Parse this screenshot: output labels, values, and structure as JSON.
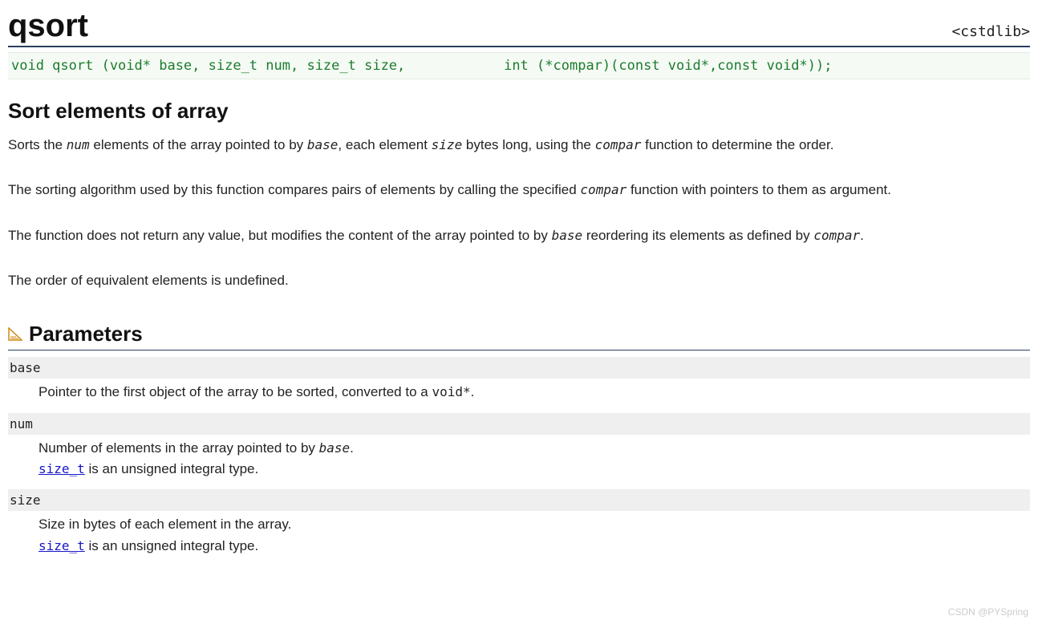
{
  "header": {
    "title": "qsort",
    "library": "<cstdlib>"
  },
  "signature": "void qsort (void* base, size_t num, size_t size,            int (*compar)(const void*,const void*));",
  "section_title": "Sort elements of array",
  "paragraphs": {
    "p1_1": "Sorts the ",
    "p1_num": "num",
    "p1_2": " elements of the array pointed to by ",
    "p1_base": "base",
    "p1_3": ", each element ",
    "p1_size": "size",
    "p1_4": " bytes long, using the ",
    "p1_compar": "compar",
    "p1_5": " function to determine the order.",
    "p2_1": "The sorting algorithm used by this function compares pairs of elements by calling the specified ",
    "p2_compar": "compar",
    "p2_2": " function with pointers to them as argument.",
    "p3_1": "The function does not return any value, but modifies the content of the array pointed to by ",
    "p3_base": "base",
    "p3_2": " reordering its elements as defined by ",
    "p3_compar": "compar",
    "p3_3": ".",
    "p4": "The order of equivalent elements is undefined."
  },
  "params_heading": "Parameters",
  "params": {
    "base": {
      "name": "base",
      "desc_1": "Pointer to the first object of the array to be sorted, converted to a ",
      "desc_code": "void*",
      "desc_2": "."
    },
    "num": {
      "name": "num",
      "desc_1": "Number of elements in the array pointed to by ",
      "desc_ital": "base",
      "desc_2": ".",
      "link_text": "size_t",
      "link_tail": " is an unsigned integral type."
    },
    "size": {
      "name": "size",
      "desc_1": "Size in bytes of each element in the array.",
      "link_text": "size_t",
      "link_tail": " is an unsigned integral type."
    }
  },
  "watermark": "CSDN @PYSpring"
}
